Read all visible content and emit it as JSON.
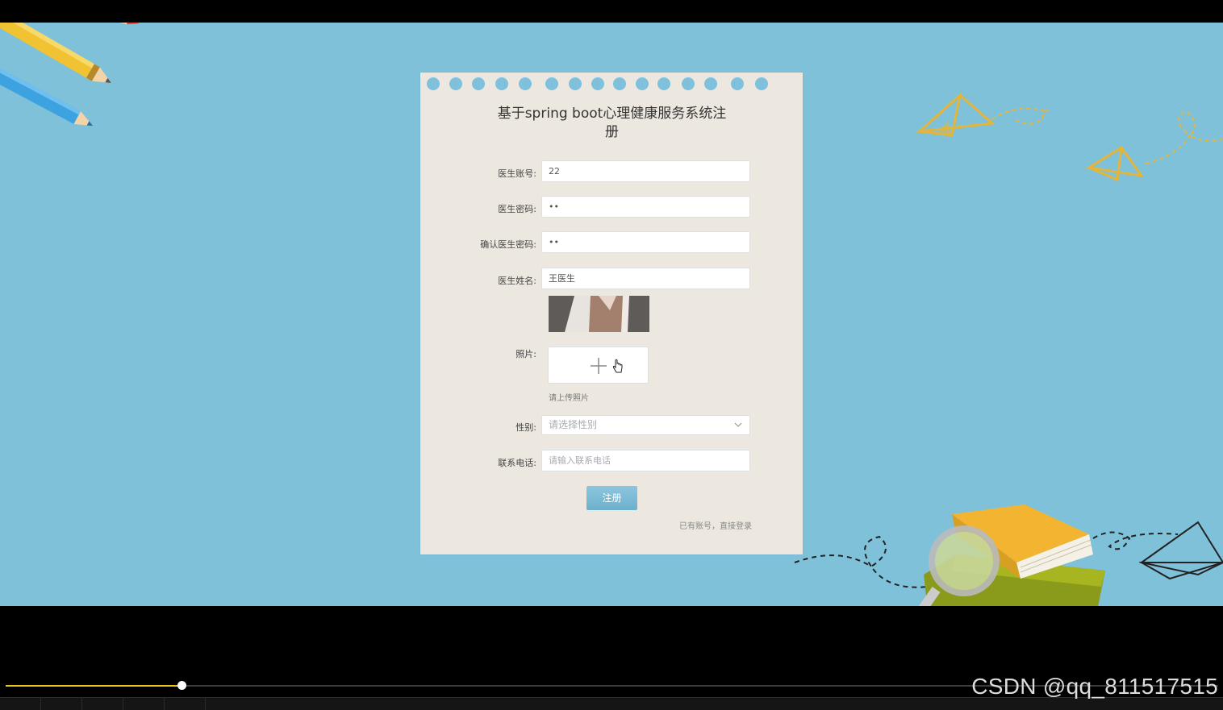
{
  "form": {
    "title": "基于spring boot心理健康服务系统注册",
    "fields": {
      "account": {
        "label": "医生账号:",
        "value": "22"
      },
      "password": {
        "label": "医生密码:",
        "value": "••"
      },
      "confirm_password": {
        "label": "确认医生密码:",
        "value": "••"
      },
      "name": {
        "label": "医生姓名:",
        "value": "王医生"
      },
      "photo": {
        "label": "照片:",
        "hint": "请上传照片"
      },
      "gender": {
        "label": "性别:",
        "placeholder": "请选择性别"
      },
      "phone": {
        "label": "联系电话:",
        "placeholder": "请输入联系电话"
      }
    },
    "submit_label": "注册",
    "login_link": "已有账号，直接登录"
  },
  "player": {
    "progress": 0.145,
    "watermark": "CSDN @qq_811517515"
  },
  "colors": {
    "background": "#80c1da",
    "card": "#ece8df",
    "button": "#79b8d3",
    "progress": "#e8c31a"
  }
}
